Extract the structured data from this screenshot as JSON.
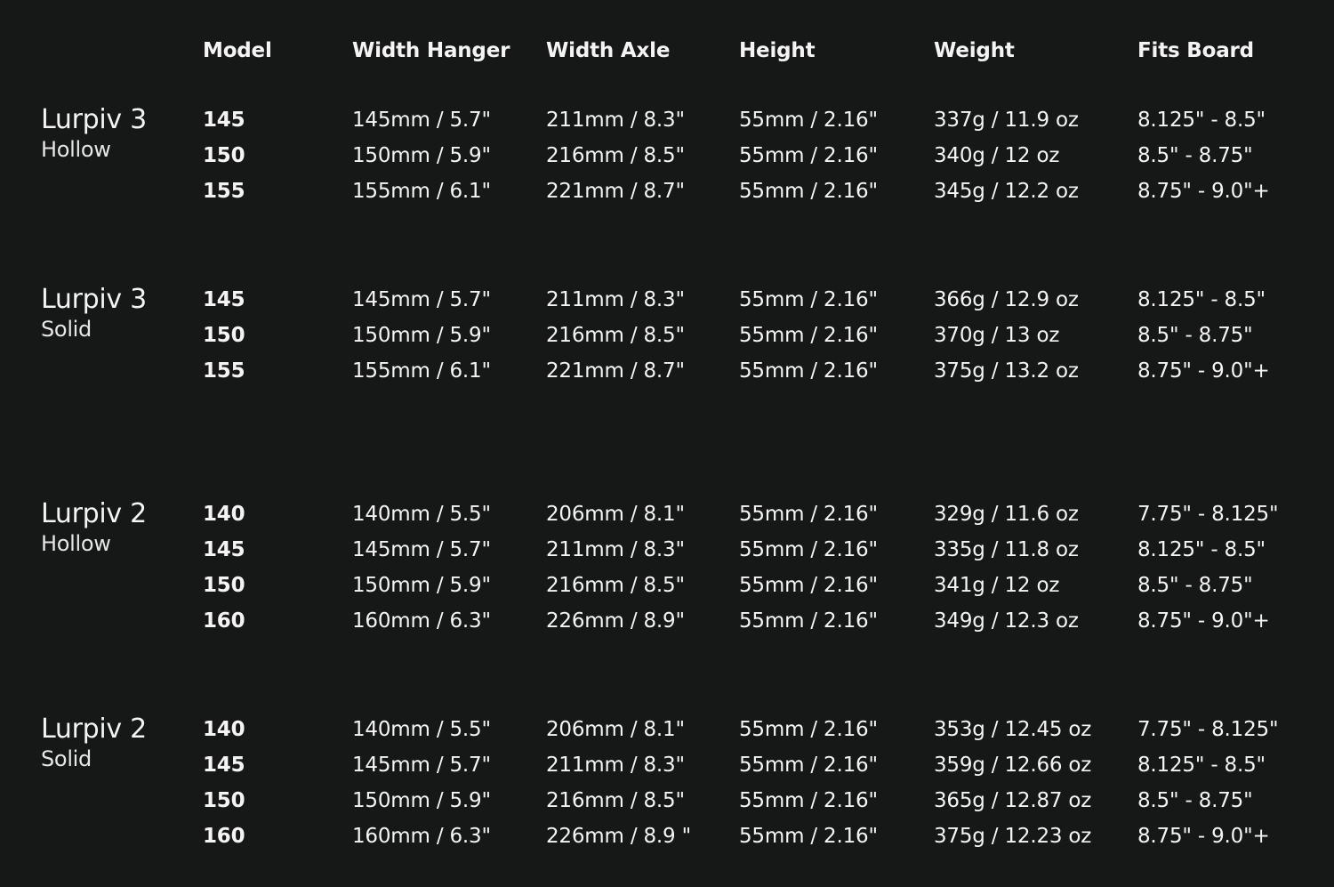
{
  "table": {
    "headers": [
      "Model",
      "Width Hanger",
      "Width Axle",
      "Height",
      "Weight",
      "Fits Board"
    ],
    "groups": [
      {
        "name": "Lurpiv 3",
        "subtitle": "Hollow",
        "rows": [
          [
            "145",
            "145mm / 5.7\"",
            "211mm / 8.3\"",
            "55mm / 2.16\"",
            "337g / 11.9 oz",
            "8.125\" - 8.5\""
          ],
          [
            "150",
            "150mm / 5.9\"",
            "216mm / 8.5\"",
            "55mm / 2.16\"",
            "340g / 12 oz",
            "8.5\" - 8.75\""
          ],
          [
            "155",
            "155mm / 6.1\"",
            "221mm / 8.7\"",
            "55mm / 2.16\"",
            "345g / 12.2 oz",
            "8.75\" - 9.0\"+"
          ]
        ]
      },
      {
        "name": "Lurpiv 3",
        "subtitle": "Solid",
        "rows": [
          [
            "145",
            "145mm / 5.7\"",
            "211mm / 8.3\"",
            "55mm / 2.16\"",
            "366g / 12.9 oz",
            "8.125\" - 8.5\""
          ],
          [
            "150",
            "150mm / 5.9\"",
            "216mm / 8.5\"",
            "55mm / 2.16\"",
            "370g / 13 oz",
            "8.5\" - 8.75\""
          ],
          [
            "155",
            "155mm / 6.1\"",
            "221mm / 8.7\"",
            "55mm / 2.16\"",
            "375g / 13.2 oz",
            "8.75\" - 9.0\"+"
          ]
        ]
      },
      {
        "name": "Lurpiv 2",
        "subtitle": "Hollow",
        "rows": [
          [
            "140",
            "140mm / 5.5\"",
            "206mm / 8.1\"",
            "55mm / 2.16\"",
            "329g / 11.6 oz",
            "7.75\" - 8.125\""
          ],
          [
            "145",
            "145mm / 5.7\"",
            "211mm / 8.3\"",
            "55mm / 2.16\"",
            "335g / 11.8 oz",
            "8.125\" - 8.5\""
          ],
          [
            "150",
            "150mm / 5.9\"",
            "216mm / 8.5\"",
            "55mm / 2.16\"",
            "341g / 12 oz",
            "8.5\" - 8.75\""
          ],
          [
            "160",
            "160mm / 6.3\"",
            "226mm / 8.9\"",
            "55mm / 2.16\"",
            "349g / 12.3 oz",
            "8.75\" - 9.0\"+"
          ]
        ]
      },
      {
        "name": "Lurpiv 2",
        "subtitle": "Solid",
        "rows": [
          [
            "140",
            "140mm / 5.5\"",
            "206mm / 8.1\"",
            "55mm / 2.16\"",
            "353g / 12.45 oz",
            "7.75\" - 8.125\""
          ],
          [
            "145",
            "145mm / 5.7\"",
            "211mm / 8.3\"",
            "55mm / 2.16\"",
            "359g / 12.66 oz",
            "8.125\" - 8.5\""
          ],
          [
            "150",
            "150mm / 5.9\"",
            "216mm / 8.5\"",
            "55mm / 2.16\"",
            "365g / 12.87 oz",
            "8.5\" - 8.75\""
          ],
          [
            "160",
            "160mm / 6.3\"",
            "226mm / 8.9 \"",
            "55mm / 2.16\"",
            "375g / 12.23 oz",
            "8.75\" - 9.0\"+"
          ]
        ]
      }
    ]
  },
  "colors": {
    "background": "#161717",
    "text": "#f4f4f4"
  }
}
